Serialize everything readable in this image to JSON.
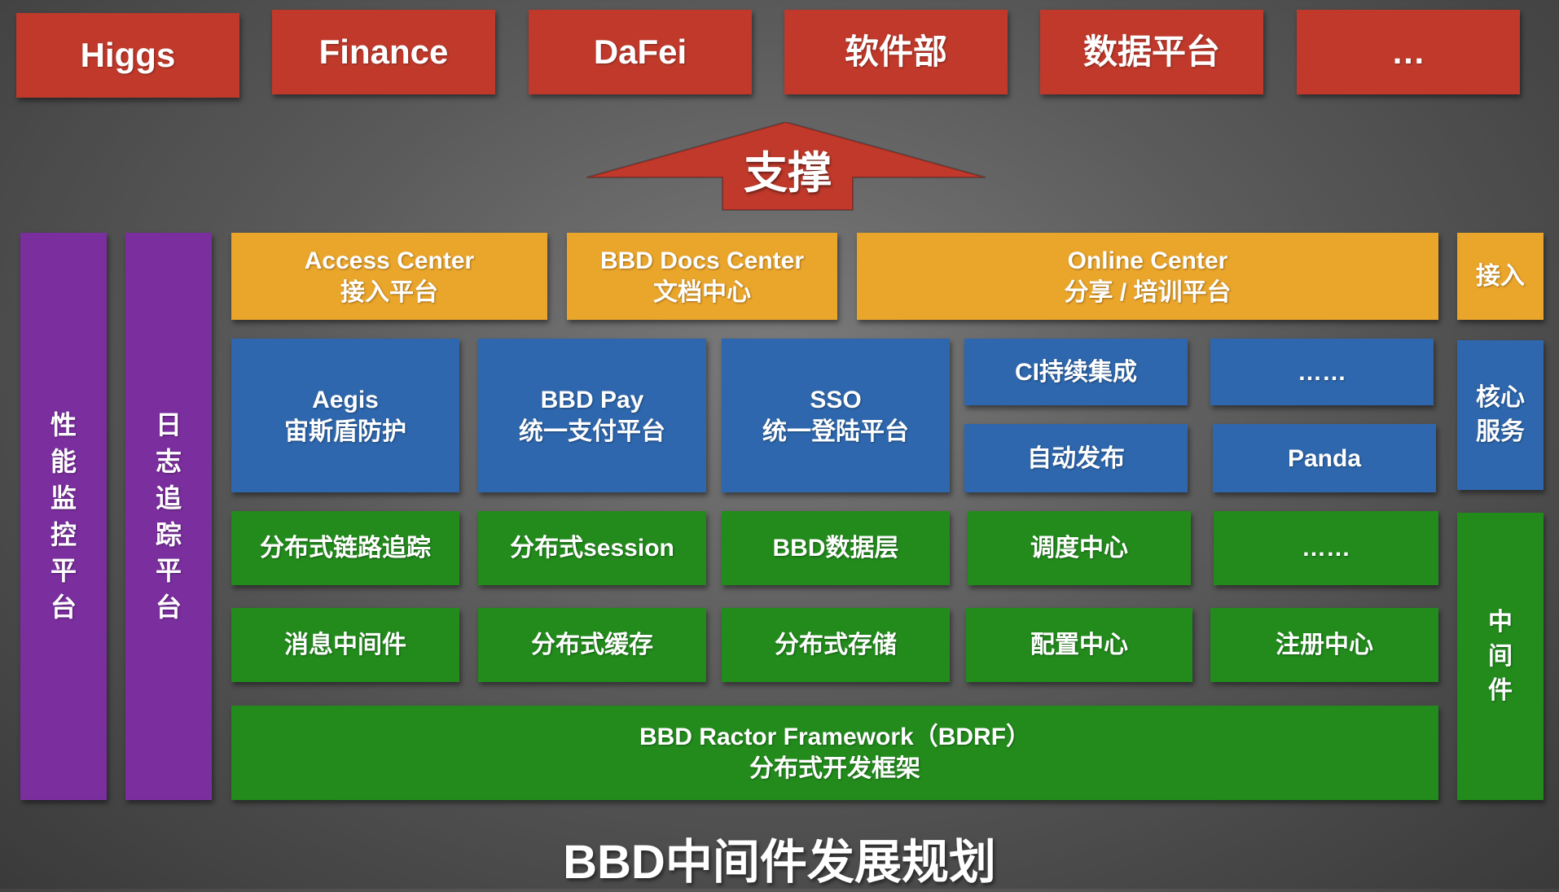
{
  "consumers": [
    "Higgs",
    "Finance",
    "DaFei",
    "软件部",
    "数据平台",
    "…"
  ],
  "support_label": "支撑",
  "side_left": [
    "性能监控平台",
    "日志追踪平台"
  ],
  "access": [
    {
      "en": "Access Center",
      "cn": "接入平台"
    },
    {
      "en": "BBD Docs Center",
      "cn": "文档中心"
    },
    {
      "en": "Online Center",
      "cn": "分享 / 培训平台"
    }
  ],
  "core": [
    {
      "en": "Aegis",
      "cn": "宙斯盾防护"
    },
    {
      "en": "BBD Pay",
      "cn": "统一支付平台"
    },
    {
      "en": "SSO",
      "cn": "统一登陆平台"
    }
  ],
  "core_small": [
    "CI持续集成",
    "……",
    "自动发布",
    "Panda"
  ],
  "middleware_row1": [
    "分布式链路追踪",
    "分布式session",
    "BBD数据层",
    "调度中心",
    "……"
  ],
  "middleware_row2": [
    "消息中间件",
    "分布式缓存",
    "分布式存储",
    "配置中心",
    "注册中心"
  ],
  "framework": {
    "en": "BBD Ractor Framework（BDRF）",
    "cn": "分布式开发框架"
  },
  "layer_labels": {
    "access": "接入",
    "core": "核心服务",
    "middleware": "中间件"
  },
  "title": "BBD中间件发展规划",
  "colors": {
    "consumer": "#c0392b",
    "access": "#eaa52b",
    "core": "#2e67ad",
    "middleware": "#228b1c",
    "monitor": "#7b2e9e"
  }
}
